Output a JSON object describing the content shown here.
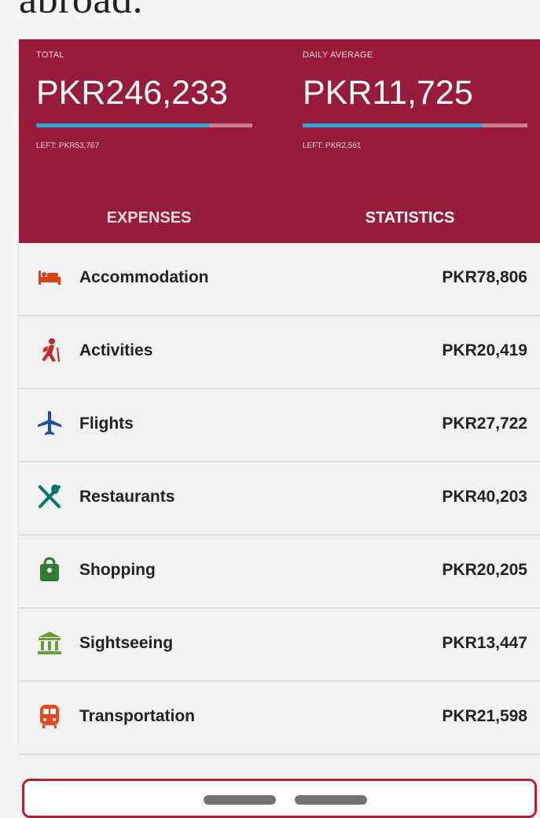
{
  "page": {
    "heading": "abroad."
  },
  "summary": {
    "total": {
      "label": "TOTAL",
      "value": "PKR246,233",
      "left": "LEFT: PKR53,767",
      "progress": 0.8
    },
    "daily_average": {
      "label": "DAILY AVERAGE",
      "value": "PKR11,725",
      "left": "LEFT: PKR2,561",
      "progress": 0.8
    }
  },
  "tabs": [
    {
      "label": "EXPENSES",
      "active": false
    },
    {
      "label": "STATISTICS",
      "active": true
    }
  ],
  "expenses": [
    {
      "name": "Accommodation",
      "amount": "PKR78,806",
      "icon": "bed-icon",
      "color": "#d84315"
    },
    {
      "name": "Activities",
      "amount": "PKR20,419",
      "icon": "hiker-icon",
      "color": "#c62828"
    },
    {
      "name": "Flights",
      "amount": "PKR27,722",
      "icon": "airplane-icon",
      "color": "#1e4fa0"
    },
    {
      "name": "Restaurants",
      "amount": "PKR40,203",
      "icon": "utensils-icon",
      "color": "#00796b"
    },
    {
      "name": "Shopping",
      "amount": "PKR20,205",
      "icon": "shopping-bag-icon",
      "color": "#2e7d32"
    },
    {
      "name": "Sightseeing",
      "amount": "PKR13,447",
      "icon": "monument-icon",
      "color": "#689f38"
    },
    {
      "name": "Transportation",
      "amount": "PKR21,598",
      "icon": "train-icon",
      "color": "#e64a19"
    }
  ],
  "theme": {
    "accent": "#981b3c",
    "progress": "#2ba9e1"
  }
}
